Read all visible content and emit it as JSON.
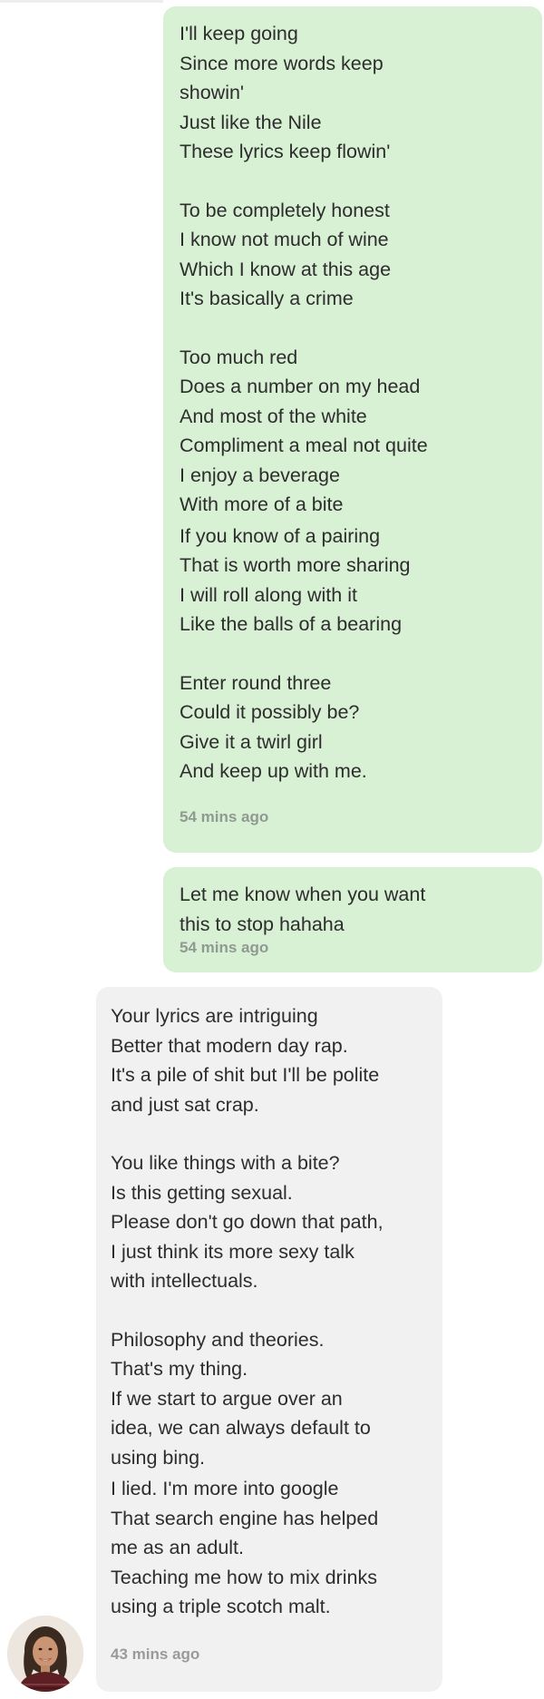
{
  "colors": {
    "sent_bubble": "#d8f0d4",
    "received_bubble": "#f1f1f1",
    "timestamp_text": "#9a9a9a"
  },
  "messages": [
    {
      "direction": "sent",
      "stanzas": [
        [
          "I'll keep going",
          "Since more words keep",
          "showin'",
          "Just like the Nile",
          "These lyrics keep flowin'"
        ],
        [
          "To be completely honest",
          "I know not much of wine",
          "Which I know at this age",
          "It's basically a crime"
        ],
        [
          "Too much red",
          "Does a number on my head",
          "And most of the white",
          "Compliment a meal not quite",
          "I enjoy a beverage",
          "With more of a bite"
        ],
        [
          "If you know of a pairing",
          "That is worth more sharing",
          "I will roll along with it",
          "Like the balls of a bearing"
        ],
        [
          "Enter round three",
          "Could it possibly be?",
          "Give it a twirl girl",
          "And keep up with me."
        ]
      ],
      "timestamp": "54 mins ago"
    },
    {
      "direction": "sent",
      "stanzas": [
        [
          "Let me know when you want",
          "this to stop hahaha"
        ]
      ],
      "timestamp": "54 mins ago"
    },
    {
      "direction": "received",
      "stanzas": [
        [
          "Your lyrics are intriguing",
          "Better that modern day rap.",
          "It's a pile of shit but I'll be polite",
          "and just sat crap."
        ],
        [
          "You like things with a bite?",
          "Is this getting sexual.",
          "Please don't go down that path,",
          "I just think its more sexy talk",
          "with intellectuals."
        ],
        [
          "Philosophy and theories.",
          "That's my thing.",
          "If we start to argue over an",
          "idea, we can always default to",
          "using bing."
        ],
        [
          "I lied. I'm more into google",
          "That search engine has helped",
          "me as an adult.",
          "Teaching me how to mix drinks",
          "using a triple scotch malt."
        ]
      ],
      "timestamp": "43 mins ago"
    }
  ],
  "avatar": {
    "icon": "contact-avatar-photo"
  }
}
